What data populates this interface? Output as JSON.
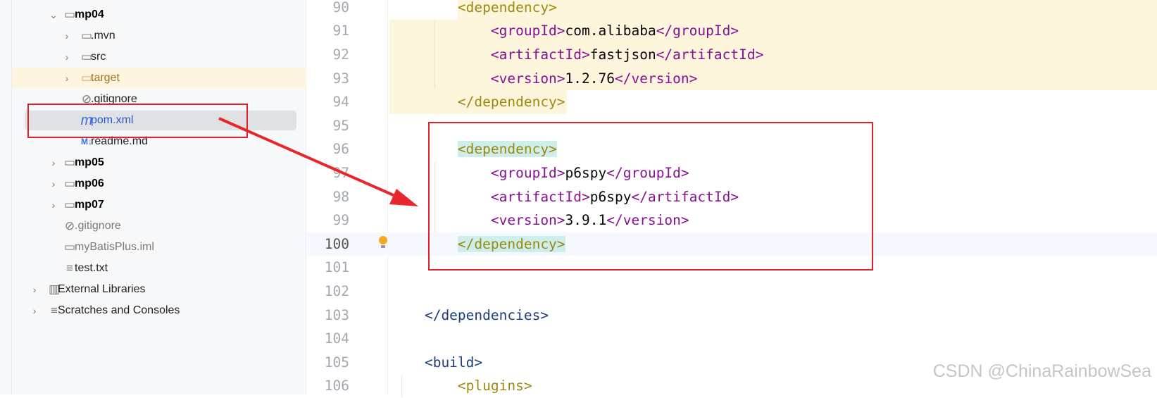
{
  "project_tree": {
    "items": [
      {
        "label": "mp04",
        "kind": "module",
        "expanded": true,
        "level": 1
      },
      {
        "label": ".mvn",
        "kind": "folder",
        "expanded": false,
        "level": 2
      },
      {
        "label": "src",
        "kind": "folder",
        "expanded": false,
        "level": 2
      },
      {
        "label": "target",
        "kind": "folder-excluded",
        "expanded": false,
        "level": 2
      },
      {
        "label": ".gitignore",
        "kind": "ignore-file",
        "level": 2
      },
      {
        "label": "pom.xml",
        "kind": "maven-file",
        "level": 2,
        "selected": true
      },
      {
        "label": "readme.md",
        "kind": "markdown-file",
        "level": 2
      },
      {
        "label": "mp05",
        "kind": "module",
        "expanded": false,
        "level": 1
      },
      {
        "label": "mp06",
        "kind": "module",
        "expanded": false,
        "level": 1
      },
      {
        "label": "mp07",
        "kind": "module",
        "expanded": false,
        "level": 1
      },
      {
        "label": ".gitignore",
        "kind": "ignore-file",
        "level": 1
      },
      {
        "label": "myBatisPlus.iml",
        "kind": "iml-file",
        "level": 1
      },
      {
        "label": "test.txt",
        "kind": "text-file",
        "level": 1
      },
      {
        "label": "External Libraries",
        "kind": "libraries",
        "level": 0
      },
      {
        "label": "Scratches and Consoles",
        "kind": "scratches",
        "level": 0
      }
    ]
  },
  "editor": {
    "current_line": 100,
    "lines": [
      {
        "n": "90",
        "tokens": [
          [
            "tagd",
            "        <dependency>"
          ]
        ]
      },
      {
        "n": "91",
        "tokens": [
          [
            "tagp",
            "            <groupId>"
          ],
          [
            "txt",
            "com.alibaba"
          ],
          [
            "tagp",
            "</groupId>"
          ]
        ]
      },
      {
        "n": "92",
        "tokens": [
          [
            "tagp",
            "            <artifactId>"
          ],
          [
            "txt",
            "fastjson"
          ],
          [
            "tagp",
            "</artifactId>"
          ]
        ]
      },
      {
        "n": "93",
        "tokens": [
          [
            "tagp",
            "            <version>"
          ],
          [
            "txt",
            "1.2.76"
          ],
          [
            "tagp",
            "</version>"
          ]
        ]
      },
      {
        "n": "94",
        "tokens": [
          [
            "tagd",
            "        </dependency>"
          ]
        ]
      },
      {
        "n": "95",
        "tokens": []
      },
      {
        "n": "96",
        "tokens": [
          [
            "tagd",
            "        <dependency>"
          ]
        ]
      },
      {
        "n": "97",
        "tokens": [
          [
            "tagp",
            "            <groupId>"
          ],
          [
            "txt",
            "p6spy"
          ],
          [
            "tagp",
            "</groupId>"
          ]
        ]
      },
      {
        "n": "98",
        "tokens": [
          [
            "tagp",
            "            <artifactId>"
          ],
          [
            "txt",
            "p6spy"
          ],
          [
            "tagp",
            "</artifactId>"
          ]
        ]
      },
      {
        "n": "99",
        "tokens": [
          [
            "tagp",
            "            <version>"
          ],
          [
            "txt",
            "3.9.1"
          ],
          [
            "tagp",
            "</version>"
          ]
        ]
      },
      {
        "n": "100",
        "tokens": [
          [
            "tagd",
            "        </dependency>"
          ]
        ]
      },
      {
        "n": "101",
        "tokens": []
      },
      {
        "n": "102",
        "tokens": []
      },
      {
        "n": "103",
        "tokens": [
          [
            "tagb",
            "    </dependencies>"
          ]
        ]
      },
      {
        "n": "104",
        "tokens": []
      },
      {
        "n": "105",
        "tokens": [
          [
            "tagb",
            "    <build>"
          ]
        ]
      },
      {
        "n": "106",
        "tokens": [
          [
            "tagd",
            "        <plugins>"
          ]
        ]
      }
    ]
  },
  "gutter_icons": {
    "line_100": "lightbulb-icon"
  },
  "annotation_color": "#e0202a",
  "watermark": "CSDN @ChinaRainbowSea"
}
